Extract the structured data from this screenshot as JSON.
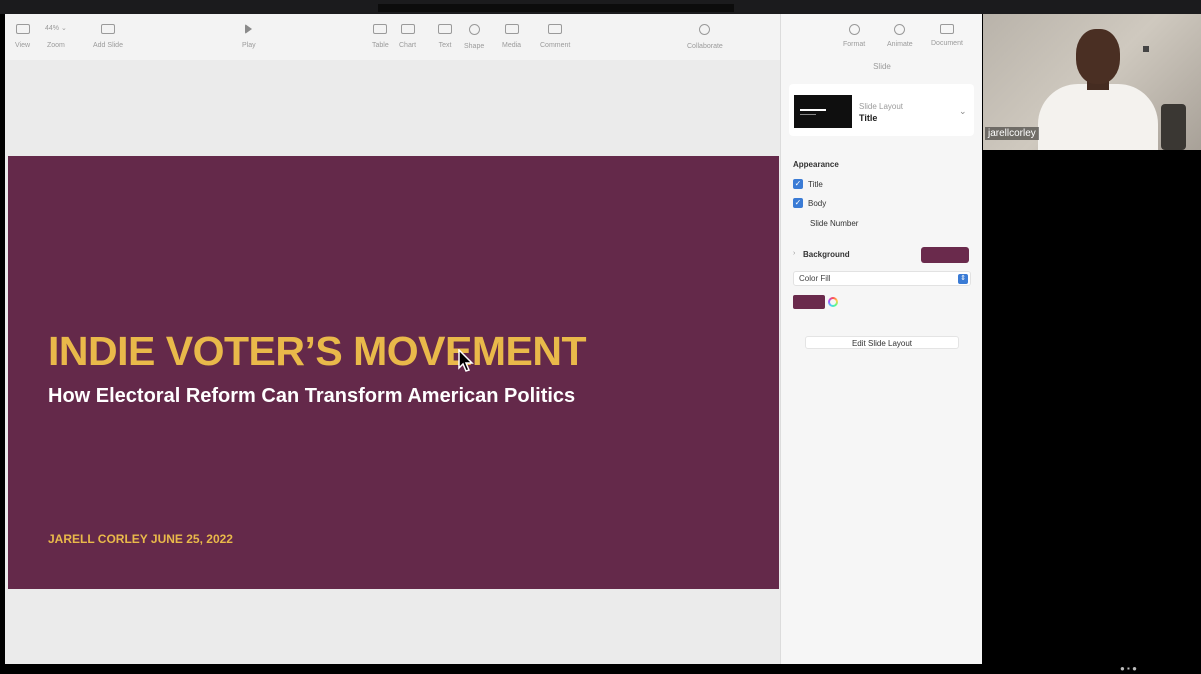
{
  "toolbar": {
    "view": "View",
    "zoom_value": "44% ⌄",
    "zoom": "Zoom",
    "add_slide": "Add Slide",
    "play": "Play",
    "table": "Table",
    "chart": "Chart",
    "text": "Text",
    "shape": "Shape",
    "media": "Media",
    "comment": "Comment",
    "collaborate": "Collaborate",
    "format": "Format",
    "animate": "Animate",
    "document": "Document"
  },
  "slide": {
    "title": "INDIE VOTER’S MOVEMENT",
    "subtitle": "How Electoral Reform Can Transform American Politics",
    "author_date": "JARELL CORLEY JUNE 25, 2022",
    "background_color": "#64294a",
    "title_color": "#e9b94a"
  },
  "panel": {
    "heading": "Slide",
    "slide_layout_label": "Slide Layout",
    "slide_layout_value": "Title",
    "appearance_label": "Appearance",
    "title_check": "Title",
    "body_check": "Body",
    "slide_number_check": "Slide Number",
    "background_label": "Background",
    "fill_type": "Color Fill",
    "edit_layout_button": "Edit Slide Layout",
    "accent_color": "#3a7bd5"
  },
  "video": {
    "participant_name": "jarellcorley"
  }
}
